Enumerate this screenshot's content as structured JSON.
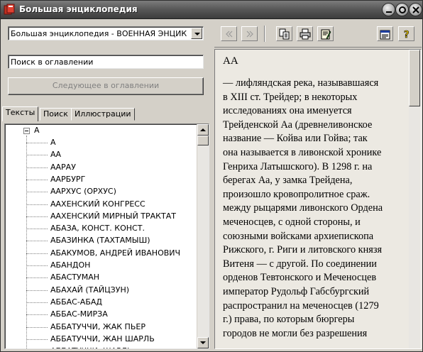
{
  "window": {
    "title": "Большая энциклопедия"
  },
  "left": {
    "encyclopedia_select": "Большая энциклопедия - ВОЕННАЯ ЭНЦИКЛОПЕДИЯ",
    "search_value": "Поиск в оглавлении",
    "next_button": "Следующее в оглавлении",
    "tabs": [
      "Тексты",
      "Поиск",
      "Иллюстрации"
    ],
    "tree": {
      "root": "А",
      "items": [
        "А",
        "АА",
        "ААРАУ",
        "ААРБУРГ",
        "ААРХУС (ОРХУС)",
        "ААХЕНСКИЙ КОНГРЕСС",
        "ААХЕНСКИЙ МИРНЫЙ ТРАКТАТ",
        "АБАЗА, КОНСТ. КОНСТ.",
        "АБАЗИНКА (ТАХТАМЫШ)",
        "АБАКУМОВ, АНДРЕЙ ИВАНОВИЧ",
        "АБАНДОН",
        "АБАСТУМАН",
        "АБАХАЙ (ТАЙЦЗУН)",
        "АББАС-АБАД",
        "АББАС-МИРЗА",
        "АББАТУЧЧИ, ЖАК ПЬЕР",
        "АББАТУЧЧИ, ЖАН ШАРЛЬ",
        "АББАТУЧЧИ, ШАРЛЬ"
      ]
    }
  },
  "right": {
    "toolbar": {
      "icons": [
        "back-icon",
        "forward-icon",
        "copy-icon",
        "print-icon",
        "edit-icon",
        "properties-icon",
        "help-icon"
      ]
    },
    "article": {
      "title": "АА",
      "lines": [
        "— лифляндская река, называвшаяся",
        "в XIII ст. Трейдер; в некоторых",
        "исследованиях она именуется",
        "Трейденской Аа (древнеливонское",
        "название — Койва или Гойва; так",
        "она называется в ливонской хронике",
        "Генриха Латышского). В 1298 г. на",
        "берегах Аа, у замка Трейдена,",
        "произошло кровопролитное сраж.",
        "между рыцарями ливонского Ордена",
        "меченосцев, с одной стороны, и",
        "союзными войсками архиепископа",
        "Рижского, г. Риги и литовского князя",
        "Витеня — с другой. По соединении",
        "орденов Тевтонского и Меченосцев",
        "император Рудольф Габсбургский",
        "распространил на меченосцев (1279",
        "г.) права, по которым бюргеры",
        "городов не могли без разрешения"
      ]
    }
  }
}
